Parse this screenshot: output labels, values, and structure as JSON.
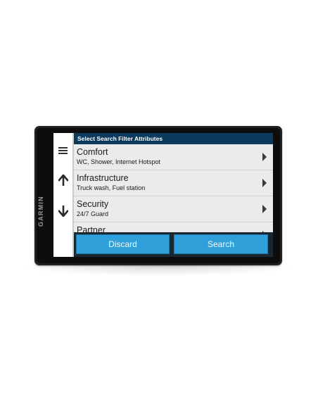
{
  "device": {
    "brand": "GARMIN"
  },
  "header": {
    "title": "Select Search Filter Attributes"
  },
  "nav": {
    "menu_icon": "menu-icon",
    "up_icon": "arrow-up-icon",
    "down_icon": "arrow-down-icon"
  },
  "list": {
    "items": [
      {
        "title": "Comfort",
        "subtitle": "WC, Shower, Internet Hotspot"
      },
      {
        "title": "Infrastructure",
        "subtitle": "Truck wash, Fuel station"
      },
      {
        "title": "Security",
        "subtitle": "24/7 Guard"
      },
      {
        "title": "Partner",
        "subtitle": ""
      }
    ]
  },
  "buttons": {
    "discard": "Discard",
    "search": "Search"
  },
  "colors": {
    "header_bg": "#0b3a5c",
    "button_bg": "#2fa0d9",
    "list_bg": "#e9ebec"
  }
}
